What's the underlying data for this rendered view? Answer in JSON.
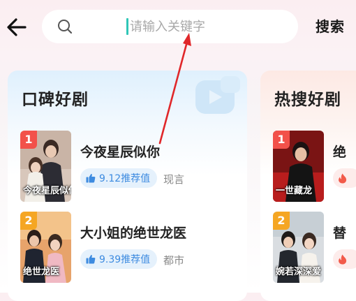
{
  "header": {
    "back_icon": "arrow-left-icon",
    "search": {
      "placeholder": "请输入关键字",
      "value": ""
    },
    "search_button_label": "搜索"
  },
  "colors": {
    "accent_caret": "#2fc6b7",
    "rank_1": "#f2514a",
    "rank_2": "#f5a623",
    "score_text": "#3d8be0",
    "annotation_arrow": "#e0272a"
  },
  "cards": [
    {
      "title": "口碑好剧",
      "items": [
        {
          "rank": "1",
          "cover_caption": "今夜星辰似你",
          "title": "今夜星辰似你",
          "score": "9.12推荐值",
          "genre": "现言",
          "score_icon": "thumbs-up-icon"
        },
        {
          "rank": "2",
          "cover_caption": "绝世龙医",
          "title": "大小姐的绝世龙医",
          "score": "9.39推荐值",
          "genre": "都市",
          "score_icon": "thumbs-up-icon"
        }
      ]
    },
    {
      "title": "热搜好剧",
      "items": [
        {
          "rank": "1",
          "cover_caption": "一世藏龙",
          "title": "绝",
          "hot_icon": "flame-icon"
        },
        {
          "rank": "2",
          "cover_caption": "婉若深深爱",
          "title": "替",
          "hot_icon": "flame-icon"
        }
      ]
    }
  ]
}
